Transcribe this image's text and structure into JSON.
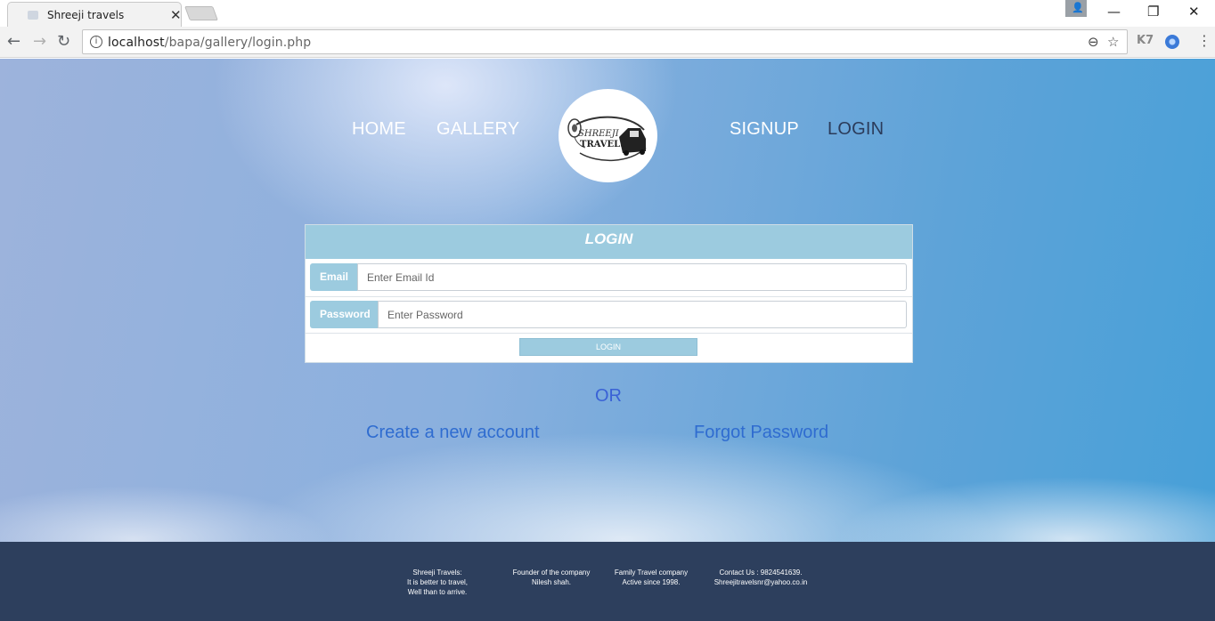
{
  "browser": {
    "tab_title": "Shreeji travels",
    "tab_close": "✕",
    "url_host": "localhost",
    "url_path": "/bapa/gallery/login.php",
    "controls": {
      "back": "←",
      "forward": "→",
      "reload": "↻",
      "minimize": "—",
      "restore": "❐",
      "close": "✕",
      "zoom": "⊖",
      "star": "☆",
      "ext_k7": "K7",
      "menu": "⋮",
      "info": "i",
      "profile": "👤"
    }
  },
  "nav": {
    "home": "HOME",
    "gallery": "GALLERY",
    "signup": "SIGNUP",
    "login": "LOGIN"
  },
  "logo": {
    "line1": "SHREEJI",
    "line2": "TRAVELS"
  },
  "login_form": {
    "title": "LOGIN",
    "email_label": "Email",
    "email_placeholder": "Enter Email Id",
    "password_label": "Password",
    "password_placeholder": "Enter Password",
    "submit_label": "LOGIN"
  },
  "or_text": "OR",
  "links": {
    "create_account": "Create a new account",
    "forgot_password": "Forgot Password"
  },
  "footer": {
    "col1": [
      "Shreeji Travels:",
      "It is better to travel,",
      "Well than to arrive."
    ],
    "col2": [
      "Founder of the company",
      "Nilesh shah."
    ],
    "col3": [
      "Family Travel company",
      "Active since 1998."
    ],
    "col4": [
      "Contact Us : 9824541639.",
      "Shreejitravelsnr@yahoo.co.in"
    ]
  },
  "colors": {
    "accent": "#9ccbdf",
    "link": "#2f6cd0",
    "footer_bg": "#2d3f5d",
    "active_nav": "#2b3b5a"
  }
}
